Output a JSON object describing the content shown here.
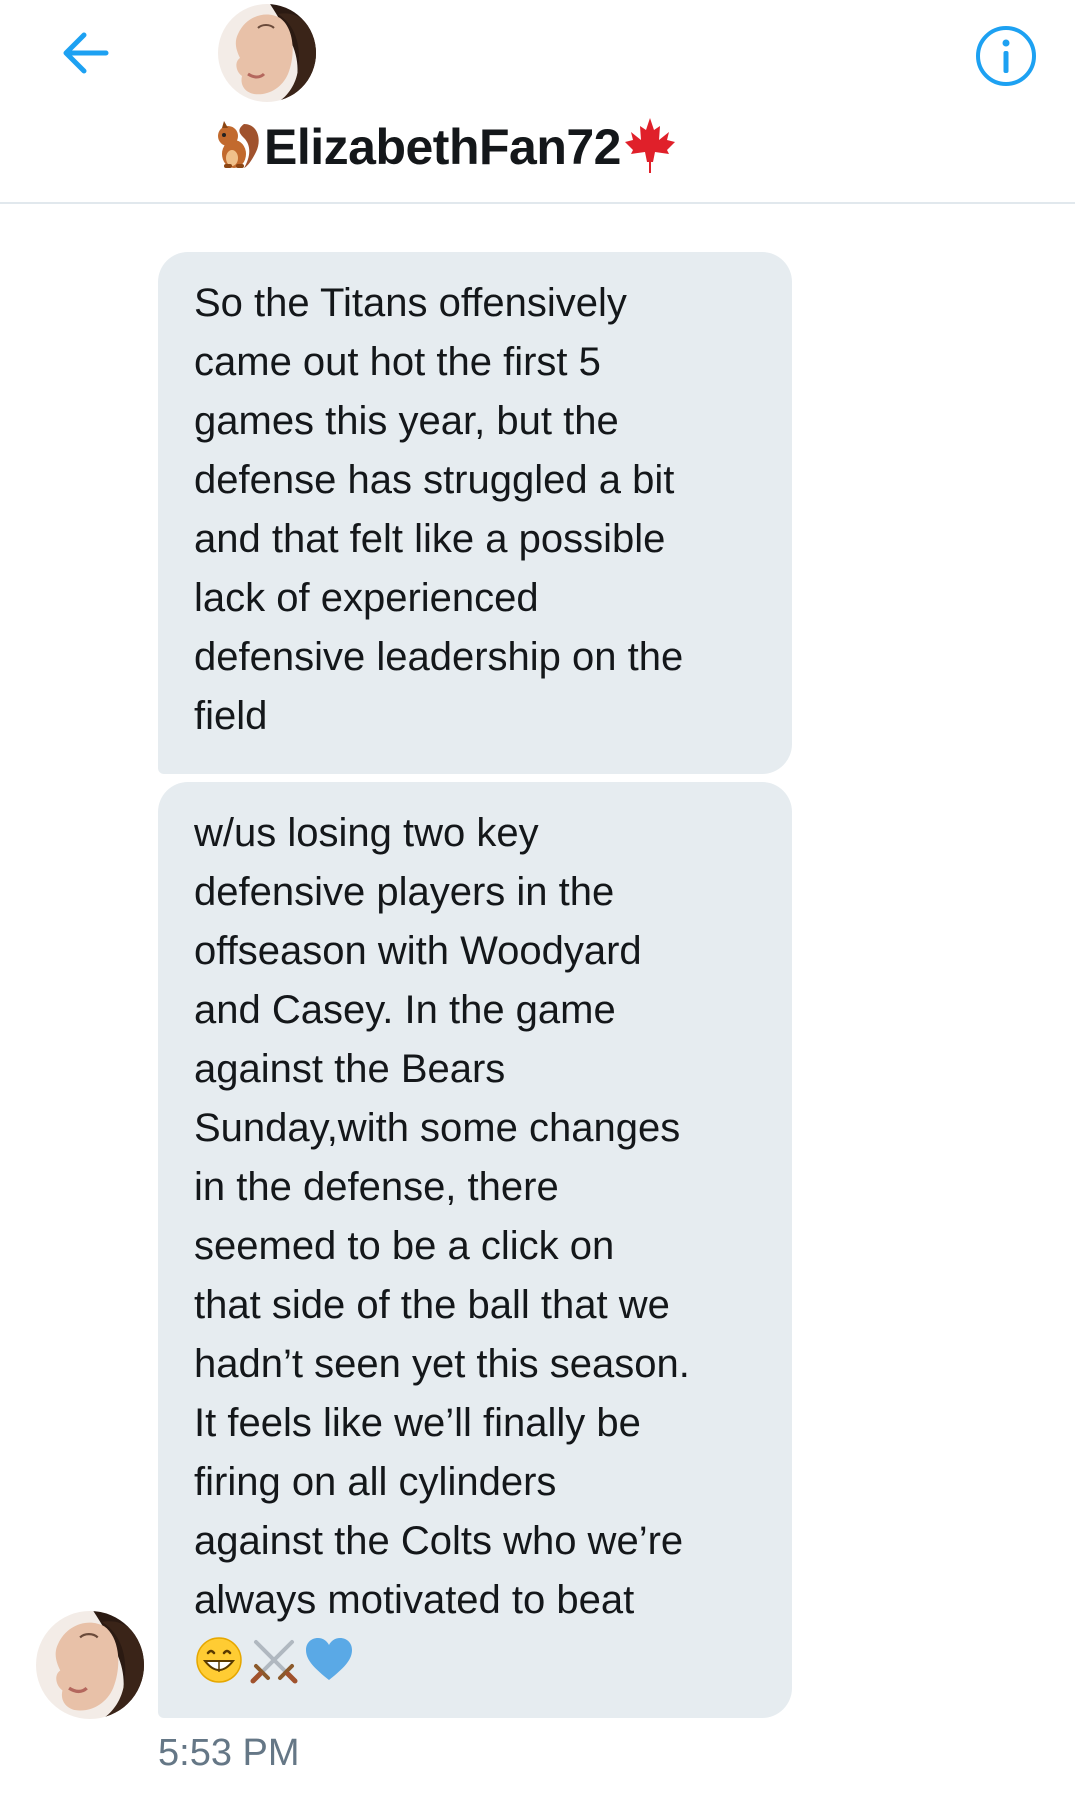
{
  "header": {
    "contact_name": "ElizabethFan72",
    "name_prefix_icon": "squirrel-icon",
    "name_suffix_icon": "maple-leaf-icon",
    "back_icon": "back-arrow-icon",
    "info_icon": "info-icon"
  },
  "colors": {
    "accent": "#1da1f2",
    "bubble": "#e6ecf0",
    "divider": "#e1e8ed",
    "timestamp": "#657786"
  },
  "messages": [
    {
      "lines": [
        "So the Titans offensively",
        "came out hot the first 5",
        "games this year, but the",
        "defense has struggled a bit",
        "and that felt like a possible",
        "lack of experienced",
        "defensive leadership on the",
        "field"
      ]
    },
    {
      "lines": [
        "w/us losing two key",
        "defensive players in the",
        "offseason with Woodyard",
        "and Casey. In the game",
        "against the Bears",
        "Sunday,with some changes",
        "in the defense, there",
        "seemed to be a click on",
        "that side of the ball that we",
        "hadn’t seen yet this season.",
        "It feels like we’ll finally be",
        "firing on all cylinders",
        "against the Colts who we’re",
        "always motivated to beat"
      ],
      "emojis": [
        "grinning-face-icon",
        "crossed-swords-icon",
        "blue-heart-icon"
      ]
    }
  ],
  "timestamp": "5:53 PM"
}
